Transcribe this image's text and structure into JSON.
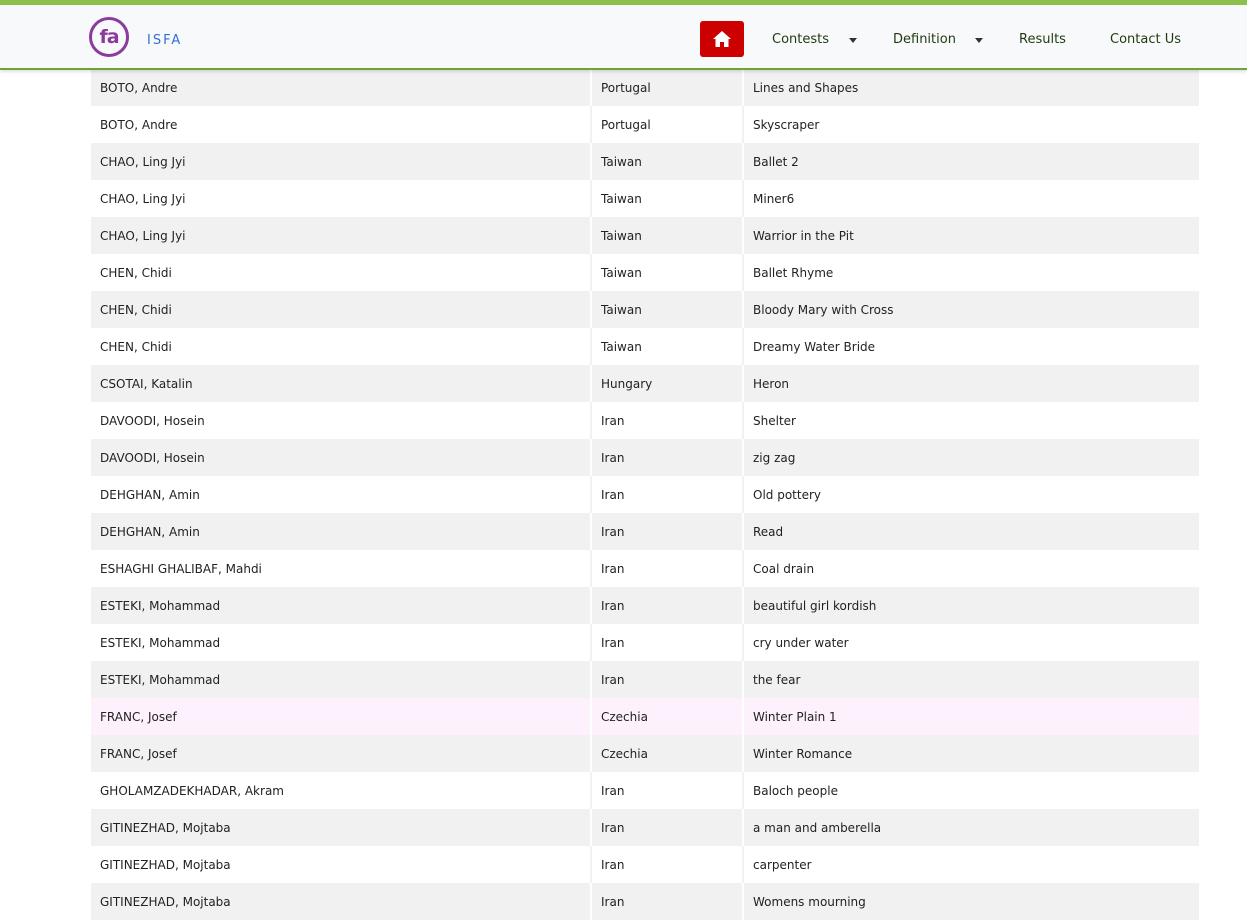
{
  "navbar": {
    "logo_text": "fa",
    "brand": "ISFA",
    "menu": [
      {
        "label": "Contests"
      },
      {
        "label": "Definition"
      },
      {
        "label": "Results"
      },
      {
        "label": "Contact Us"
      }
    ],
    "colors": {
      "accent_bar": "#8dc04a",
      "home_button": "#cc0000",
      "logo": "#8b3a9e",
      "brand_text": "#2f6fd6"
    },
    "icons": [
      "home-icon",
      "chevron-down-icon"
    ]
  },
  "table": {
    "rows": [
      {
        "name": "BOTO, Andre",
        "country": "Portugal",
        "title": "Lines and Shapes"
      },
      {
        "name": "BOTO, Andre",
        "country": "Portugal",
        "title": "Skyscraper"
      },
      {
        "name": "CHAO, Ling Jyi",
        "country": "Taiwan",
        "title": "Ballet 2"
      },
      {
        "name": "CHAO, Ling Jyi",
        "country": "Taiwan",
        "title": "Miner6"
      },
      {
        "name": "CHAO, Ling Jyi",
        "country": "Taiwan",
        "title": "Warrior in the Pit"
      },
      {
        "name": "CHEN, Chidi",
        "country": "Taiwan",
        "title": "Ballet Rhyme"
      },
      {
        "name": "CHEN, Chidi",
        "country": "Taiwan",
        "title": "Bloody Mary with Cross"
      },
      {
        "name": "CHEN, Chidi",
        "country": "Taiwan",
        "title": "Dreamy Water Bride"
      },
      {
        "name": "CSOTAI, Katalin",
        "country": "Hungary",
        "title": "Heron"
      },
      {
        "name": "DAVOODI, Hosein",
        "country": "Iran",
        "title": "Shelter"
      },
      {
        "name": "DAVOODI, Hosein",
        "country": "Iran",
        "title": "zig zag"
      },
      {
        "name": "DEHGHAN, Amin",
        "country": "Iran",
        "title": "Old pottery"
      },
      {
        "name": "DEHGHAN, Amin",
        "country": "Iran",
        "title": "Read"
      },
      {
        "name": "ESHAGHI GHALIBAF, Mahdi",
        "country": "Iran",
        "title": "Coal drain"
      },
      {
        "name": "ESTEKI, Mohammad",
        "country": "Iran",
        "title": "beautiful girl kordish"
      },
      {
        "name": "ESTEKI, Mohammad",
        "country": "Iran",
        "title": "cry under water"
      },
      {
        "name": "ESTEKI, Mohammad",
        "country": "Iran",
        "title": "the fear"
      },
      {
        "name": "FRANC, Josef",
        "country": "Czechia",
        "title": "Winter Plain 1",
        "highlight": true
      },
      {
        "name": "FRANC, Josef",
        "country": "Czechia",
        "title": "Winter Romance"
      },
      {
        "name": "GHOLAMZADEKHADAR, Akram",
        "country": "Iran",
        "title": "Baloch people"
      },
      {
        "name": "GITINEZHAD, Mojtaba",
        "country": "Iran",
        "title": "a man and amberella"
      },
      {
        "name": "GITINEZHAD, Mojtaba",
        "country": "Iran",
        "title": "carpenter"
      },
      {
        "name": "GITINEZHAD, Mojtaba",
        "country": "Iran",
        "title": "Womens mourning"
      }
    ]
  }
}
